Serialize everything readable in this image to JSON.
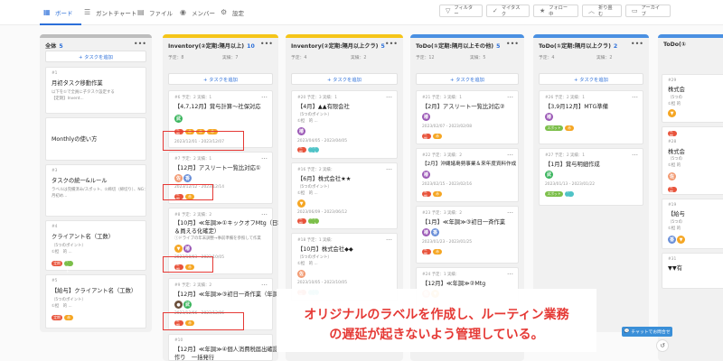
{
  "tabs": [
    {
      "label": "ボード",
      "icon": "board-icon"
    },
    {
      "label": "ガントチャート",
      "icon": "gantt-icon"
    },
    {
      "label": "ファイル",
      "icon": "file-icon"
    },
    {
      "label": "メンバー",
      "icon": "members-icon"
    },
    {
      "label": "設定",
      "icon": "gear-icon"
    }
  ],
  "actions": [
    {
      "label": "フィルター",
      "icon": "filter-icon"
    },
    {
      "label": "マイタスク",
      "icon": "check-icon"
    },
    {
      "label": "フォロー中",
      "icon": "star-icon"
    },
    {
      "label": "折り畳む",
      "icon": "collapse-icon"
    },
    {
      "label": "アーカイブ",
      "icon": "archive-icon"
    }
  ],
  "add_task_label": "+ タスクを追加",
  "columns": [
    {
      "title": "全体",
      "count": "5",
      "stripe": "#bdbdbd",
      "plan": "",
      "actual": ""
    },
    {
      "title": "Inventory(②定期:隔月以上)",
      "count": "10",
      "stripe": "#f5c518",
      "plan": "予定：8",
      "actual": "実績：7"
    },
    {
      "title": "Inventory(②定期:隔月以上クラ)",
      "count": "5",
      "stripe": "#f5c518",
      "plan": "予定：4",
      "actual": "実績：2"
    },
    {
      "title": "ToDo(①定期:隔月以上その他)",
      "count": "5",
      "stripe": "#4a90e2",
      "plan": "予定：12",
      "actual": "実績：5"
    },
    {
      "title": "ToDo(①定期:隔月以上クラ)",
      "count": "2",
      "stripe": "#4a90e2",
      "plan": "予定：4",
      "actual": "実績：2"
    },
    {
      "title": "ToDo(①",
      "count": "",
      "stripe": "#4a90e2",
      "plan": "",
      "actual": ""
    }
  ],
  "col1_cards": [
    {
      "id": "#1",
      "title": "月初タスク移動作業",
      "sub1": "以下を①で全員に子タスク設定する",
      "sub2": "【定期】Invent..."
    },
    {
      "id": "",
      "title": "Monthlyの使い方",
      "sub1": "",
      "sub2": ""
    },
    {
      "id": "#3",
      "title": "タスクの統一&ルール",
      "sub1": "ラベルは完備済み/スポット、②締切（締切り）、NG：",
      "sub2": "月初め..."
    },
    {
      "id": "#4",
      "title": "クライアント名（工数）",
      "sub1": "（5つのポイント）",
      "sub2": "①担　的 ..."
    },
    {
      "id": "#5",
      "title": "【給与】クライアント名（工数）",
      "sub1": "（5つのポイント）",
      "sub2": "①担　的 ..."
    }
  ],
  "col2_cards": [
    {
      "id": "#6  予定：2  実績：1",
      "title": "【4,7,12月】賞与計算〜社保対応",
      "date": "2023/12/01 - 2023/12/07"
    },
    {
      "id": "#7  予定：2  実績：1",
      "title": "【12月】アスリート一覧比対応①",
      "date": "2023/12/12 - 2023/12/14"
    },
    {
      "id": "#8  予定：2  実績：2",
      "title": "【10月】≪年調≫①キックオフMtg（日程",
      "title2": "＆員える化確定）",
      "sub": "ⓘドライブの年末調整→事前準備を参照して作業",
      "date": "2023/10/03 - 2023/10/05"
    },
    {
      "id": "#9  予定：2  実績：2",
      "title": "【12月】≪年調≫③初日一斉作業（年調）",
      "date": "2023/12/06 - 2023/12/06"
    },
    {
      "id": "#10",
      "title": "【12月】≪年調≫④個人消費税届出確認＋",
      "title2": "作り　一括発行"
    }
  ],
  "col3_cards": [
    {
      "id": "#20  予定：3  実績：1",
      "title": "【4月】▲▲有限会社",
      "sub1": "（5つのポイント）",
      "sub2": "①担　的 ...",
      "date": "2023/04/05 - 2023/04/05"
    },
    {
      "id": "#16  予定：2  実績：",
      "title": "【6月】株式会社★★",
      "sub1": "（5つのポイント）",
      "sub2": "①担　的 ...",
      "date": "2023/06/09 - 2023/06/12"
    },
    {
      "id": "#18  予定：1  実績：",
      "title": "【10月】株式会社◆◆",
      "sub1": "（5つのポイント）",
      "sub2": "①担　的 ...",
      "date": "2023/10/05 - 2023/10/05"
    }
  ],
  "col4_cards": [
    {
      "id": "#21  予定：3  実績：1",
      "title": "【2月】アスリート一覧比対応②",
      "date": "2023/02/07 - 2023/02/08"
    },
    {
      "id": "#22  予定：3  実績：2",
      "title": "【2月】沖縄諸島勢事業＆来年度資料作成",
      "date": "2023/02/15 - 2023/02/16"
    },
    {
      "id": "#23  予定：3  実績：2",
      "title": "【1月】≪年調≫③初日一斉作業",
      "date": "2023/01/23 - 2023/01/25"
    },
    {
      "id": "#24  予定：1  実績：",
      "title": "【12月】≪年調≫②Mtg",
      "date": ""
    }
  ],
  "col5_cards": [
    {
      "id": "#26  予定：2  実績：1",
      "title": "【3,9月12月】MTG準備",
      "date": "2023/03/15 - 2023/03/15"
    },
    {
      "id": "#27  予定：2  実績：1",
      "title": "【1月】賞与明細作成",
      "date": "2023/01/13 - 2023/01/22"
    }
  ],
  "col6_cards": [
    {
      "id": "#29",
      "title": "株式会",
      "sub1": "（5つの",
      "sub2": "①担 的"
    },
    {
      "id": "#28",
      "title": "株式会",
      "sub1": "（5つの",
      "sub2": "①担 的"
    },
    {
      "id": "#19",
      "title": "【給与",
      "sub1": "（5つの",
      "sub2": "①担 的"
    },
    {
      "id": "#31",
      "title": "▼▼有",
      "sub1": "",
      "sub2": ""
    }
  ],
  "labels": {
    "teiki": "定期",
    "spot": "スポット",
    "red": "赤"
  },
  "avatars": {
    "take": "武",
    "tsuba": "椿",
    "sa": "佐",
    "ka": "香"
  },
  "overlay": {
    "line1": "オリジナルのラベルを作成し、ルーティン業務",
    "line2": "の遅延が起きないよう管理している。"
  },
  "chat_label": "チャットでお問合せ",
  "colors": {
    "accent": "#2c6fd9",
    "highlight": "#e53935",
    "yellow": "#f5c518",
    "blue": "#4a90e2"
  }
}
